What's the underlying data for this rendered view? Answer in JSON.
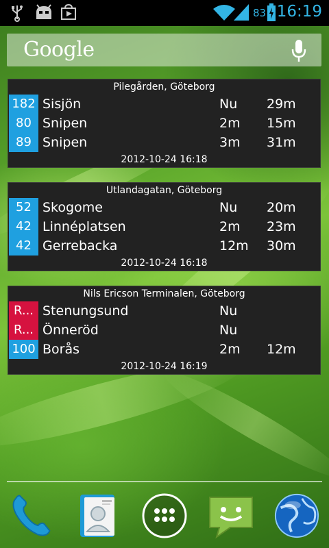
{
  "status_bar": {
    "time": "16:19",
    "battery_percent": "83",
    "icons": [
      "usb-icon",
      "android-debug-icon",
      "play-store-icon",
      "wifi-icon",
      "signal-icon",
      "battery-charging-icon"
    ]
  },
  "search": {
    "logo_text": "Google",
    "icon": "mic-icon"
  },
  "colors": {
    "blue_badge": "#1fa0e0",
    "red_badge": "#d6123f",
    "widget_bg": "#222222",
    "time_color": "#33b5e5"
  },
  "widgets": [
    {
      "title": "Pilegården, Göteborg",
      "rows": [
        {
          "line": "182",
          "dest": "Sisjön",
          "t1": "Nu",
          "t2": "29m",
          "color": "#1fa0e0"
        },
        {
          "line": "80",
          "dest": "Snipen",
          "t1": "2m",
          "t2": "15m",
          "color": "#1fa0e0"
        },
        {
          "line": "89",
          "dest": "Snipen",
          "t1": "3m",
          "t2": "31m",
          "color": "#1fa0e0"
        }
      ],
      "updated": "2012-10-24 16:18"
    },
    {
      "title": "Utlandagatan, Göteborg",
      "rows": [
        {
          "line": "52",
          "dest": "Skogome",
          "t1": "Nu",
          "t2": "20m",
          "color": "#1fa0e0"
        },
        {
          "line": "42",
          "dest": "Linnéplatsen",
          "t1": "2m",
          "t2": "23m",
          "color": "#1fa0e0"
        },
        {
          "line": "42",
          "dest": "Gerrebacka",
          "t1": "12m",
          "t2": "30m",
          "color": "#1fa0e0"
        }
      ],
      "updated": "2012-10-24 16:18"
    },
    {
      "title": "Nils Ericson Terminalen, Göteborg",
      "rows": [
        {
          "line": "R...",
          "dest": "Stenungsund",
          "t1": "Nu",
          "t2": "",
          "color": "#d6123f"
        },
        {
          "line": "R...",
          "dest": "Önneröd",
          "t1": "Nu",
          "t2": "",
          "color": "#d6123f"
        },
        {
          "line": "100",
          "dest": "Borås",
          "t1": "2m",
          "t2": "12m",
          "color": "#1fa0e0"
        }
      ],
      "updated": "2012-10-24 16:19"
    }
  ],
  "dock": {
    "apps": [
      "phone-icon",
      "contacts-icon",
      "app-drawer-icon",
      "messaging-icon",
      "browser-globe-icon"
    ]
  }
}
